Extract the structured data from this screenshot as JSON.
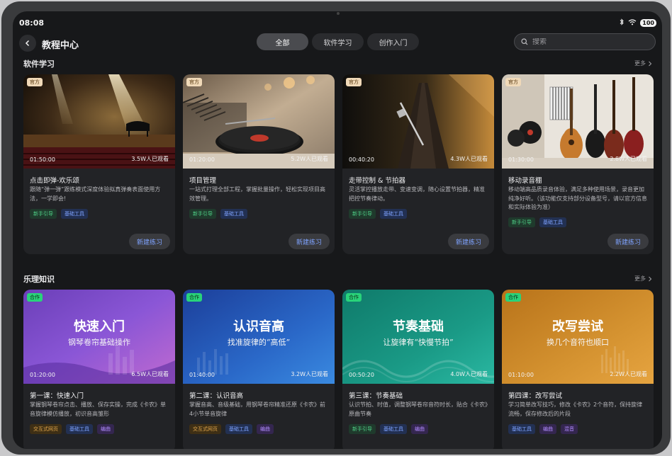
{
  "status": {
    "time": "08:08",
    "battery": "100"
  },
  "header": {
    "title": "教程中心",
    "search_placeholder": "搜索"
  },
  "tabs": [
    {
      "label": "全部",
      "active": true
    },
    {
      "label": "软件学习",
      "active": false
    },
    {
      "label": "创作入门",
      "active": false
    }
  ],
  "sections": [
    {
      "title": "软件学习",
      "more": "更多",
      "cards": [
        {
          "badge": "官方",
          "duration": "01:50:00",
          "views": "3.5W人已观看",
          "title": "点击即弹-欢乐颂",
          "desc": "跟随“弹一弹”跟练模式深度体验拟真弹奏表面使用方法，一学即会!",
          "tags": [
            "新手引导",
            "基础工具"
          ],
          "action": "新建练习"
        },
        {
          "badge": "官方",
          "duration": "01:20:00",
          "views": "5.2W人已观看",
          "title": "项目管理",
          "desc": "一站式打理全部工程，掌握批量操作，轻松实现项目高效管理。",
          "tags": [
            "新手引导",
            "基础工具"
          ],
          "action": "新建练习"
        },
        {
          "badge": "官方",
          "duration": "00:40:20",
          "views": "4.3W人已观看",
          "title": "走带控制 & 节拍器",
          "desc": "灵活掌控播放走带、变速变调，随心设置节拍器，精准把控节奏律动。",
          "tags": [
            "新手引导",
            "基础工具"
          ],
          "action": "新建练习"
        },
        {
          "badge": "官方",
          "duration": "01:30:00",
          "views": "2.8W人已观看",
          "title": "移动录音棚",
          "desc": "移动端高品质录音体验，满足多种使用场景，录音更加纯净好听。（该功能仅支持部分设备型号，请以官方信息和实际体验为准）",
          "tags": [
            "新手引导",
            "基础工具"
          ],
          "action": "新建练习"
        }
      ]
    },
    {
      "title": "乐理知识",
      "more": "更多",
      "cards": [
        {
          "badge": "合作",
          "cover_title": "快速入门",
          "cover_sub": "钢琴卷帘基础操作",
          "duration": "01:20:00",
          "views": "6.5W人已观看",
          "title": "第一课：快速入门",
          "desc": "掌握钢琴卷帘点击、播放、保存实操，完成《卡农》单音旋律模仿播放，初识音高雏形",
          "tags": [
            "交互式网页",
            "基础工具",
            "编曲"
          ]
        },
        {
          "badge": "合作",
          "cover_title": "认识音高",
          "cover_sub": "找准旋律的“高低”",
          "duration": "01:40:00",
          "views": "3.2W人已观看",
          "title": "第二课：认识音高",
          "desc": "掌握音高、音级基础，用钢琴卷帘精准还原《卡农》前4小节单音旋律",
          "tags": [
            "交互式网页",
            "基础工具",
            "编曲"
          ]
        },
        {
          "badge": "合作",
          "cover_title": "节奏基础",
          "cover_sub": "让旋律有“快慢节拍”",
          "duration": "00:50:20",
          "views": "4.0W人已观看",
          "title": "第三课：节奏基础",
          "desc": "认识节拍、时值，调整钢琴卷帘音符时长，贴合《卡农》原曲节奏",
          "tags": [
            "新手引导",
            "基础工具",
            "编曲"
          ]
        },
        {
          "badge": "合作",
          "cover_title": "改写尝试",
          "cover_sub": "换几个音符也顺口",
          "duration": "01:10:00",
          "views": "2.2W人已观看",
          "title": "第四课：改写尝试",
          "desc": "学习简单改写技巧，修改《卡农》2个音符，保持旋律流畅，保存修改后的片段",
          "tags": [
            "基础工具",
            "编曲",
            "混音"
          ]
        }
      ]
    }
  ]
}
